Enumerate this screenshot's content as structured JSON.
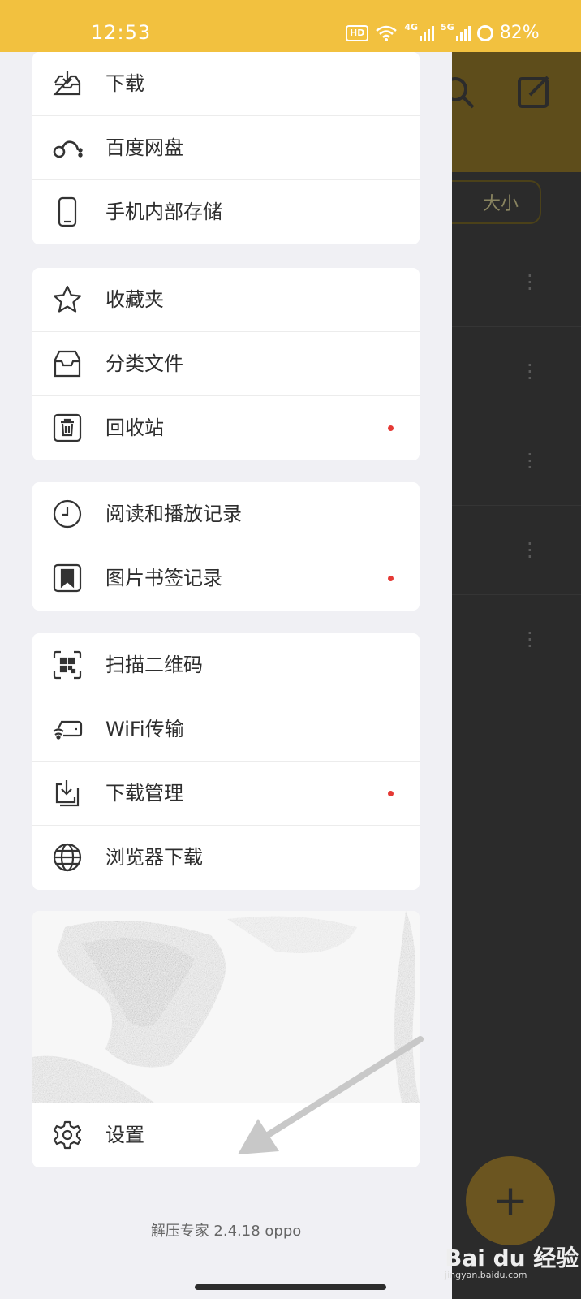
{
  "status_bar": {
    "time": "12:53",
    "hd_badge": "HD",
    "net1": "4G",
    "net2": "5G",
    "battery": "82%"
  },
  "background_app": {
    "sort_label": "大小"
  },
  "drawer": {
    "group1": [
      {
        "label": "下载",
        "icon": "download-tray-icon"
      },
      {
        "label": "百度网盘",
        "icon": "baidu-netdisk-icon"
      },
      {
        "label": "手机内部存储",
        "icon": "phone-icon"
      }
    ],
    "group2": [
      {
        "label": "收藏夹",
        "icon": "star-icon"
      },
      {
        "label": "分类文件",
        "icon": "category-box-icon"
      },
      {
        "label": "回收站",
        "icon": "trash-icon",
        "badge": true
      }
    ],
    "group3": [
      {
        "label": "阅读和播放记录",
        "icon": "clock-icon"
      },
      {
        "label": "图片书签记录",
        "icon": "bookmark-icon",
        "badge": true
      }
    ],
    "group4": [
      {
        "label": "扫描二维码",
        "icon": "qr-scan-icon"
      },
      {
        "label": "WiFi传输",
        "icon": "wifi-transfer-icon"
      },
      {
        "label": "下载管理",
        "icon": "download-manage-icon",
        "badge": true
      },
      {
        "label": "浏览器下载",
        "icon": "globe-icon"
      }
    ],
    "settings": {
      "label": "设置",
      "icon": "gear-icon"
    },
    "version": "解压专家 2.4.18 oppo"
  },
  "watermark": {
    "brand": "Bai du 经验",
    "site": "jingyan.baidu.com"
  },
  "colors": {
    "status_bar": "#f2c13f",
    "badge": "#e53935"
  }
}
